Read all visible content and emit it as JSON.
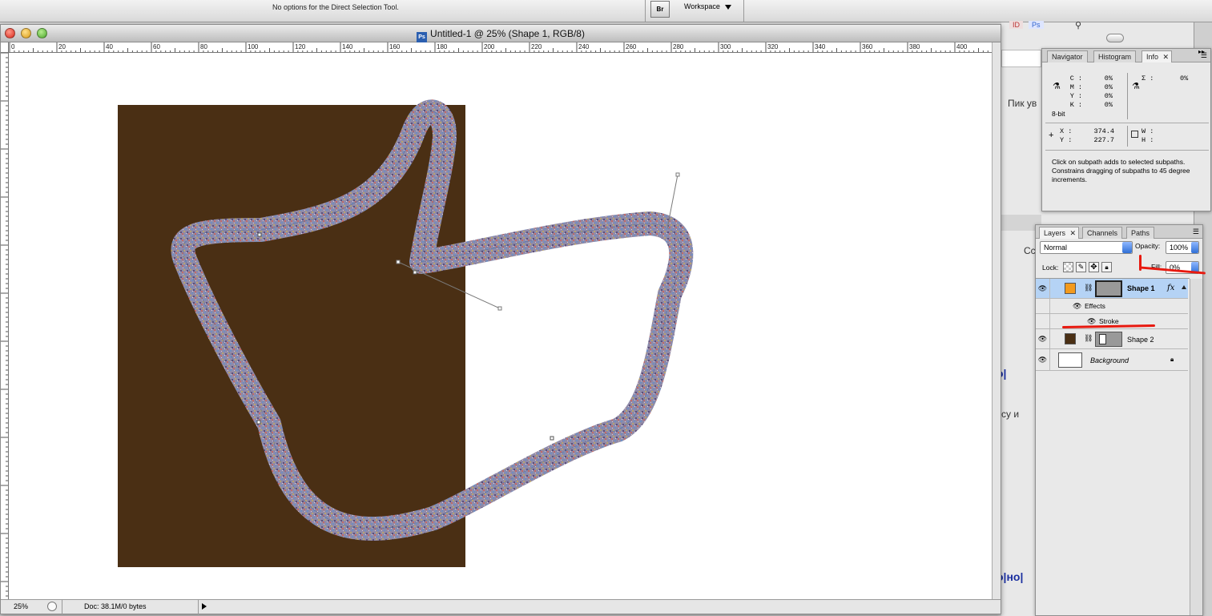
{
  "options_bar": {
    "message": "No options for the Direct Selection Tool.",
    "bridge_label": "Br",
    "workspace_label": "Workspace"
  },
  "document": {
    "title": "Untitled-1 @ 25% (Shape 1, RGB/8)",
    "app_icon_label": "Ps",
    "ruler_labels": [
      "0",
      "20",
      "40",
      "60",
      "80",
      "100",
      "120",
      "140",
      "160",
      "180",
      "200",
      "220",
      "240",
      "260",
      "280",
      "300",
      "320",
      "340",
      "360",
      "380",
      "400"
    ],
    "zoom": "25%",
    "doc_info": "Doc: 38.1M/0 bytes",
    "colors": {
      "brown_rect": "#4a2f14",
      "canvas": "#ffffff"
    }
  },
  "info_panel": {
    "tabs": [
      "Navigator",
      "Histogram",
      "Info"
    ],
    "active_tab": "Info",
    "cmyk": [
      {
        "label": "C :",
        "value": "0%"
      },
      {
        "label": "M :",
        "value": "0%"
      },
      {
        "label": "Y :",
        "value": "0%"
      },
      {
        "label": "K :",
        "value": "0%"
      }
    ],
    "bit_depth": "8-bit",
    "sigma_label": "Σ :",
    "sigma_value": "0%",
    "x_label": "X :",
    "x_value": "374.4",
    "y_label": "Y :",
    "y_value": "227.7",
    "w_label": "W :",
    "h_label": "H :",
    "hint": "Click on subpath adds to selected subpaths. Constrains dragging of subpaths to 45 degree increments."
  },
  "layers_panel": {
    "tabs": [
      "Layers",
      "Channels",
      "Paths"
    ],
    "active_tab": "Layers",
    "blend_mode": "Normal",
    "opacity_label": "Opacity:",
    "opacity_value": "100%",
    "lock_label": "Lock:",
    "fill_label": "Fill:",
    "fill_value": "0%",
    "layers": [
      {
        "name": "Shape 1",
        "fx": "fx",
        "swatch": "#f39a1d",
        "selected": true
      },
      {
        "name": "Effects"
      },
      {
        "name": "Stroke"
      },
      {
        "name": "Shape 2",
        "swatch": "#4a2f14"
      },
      {
        "name": "Background"
      }
    ]
  },
  "background_app": {
    "text1": "Пик ув",
    "text2": "Сс",
    "text3": "су и",
    "bold1": "о|",
    "bold2": "о|но|",
    "tags": [
      "ID",
      "Ps"
    ]
  }
}
